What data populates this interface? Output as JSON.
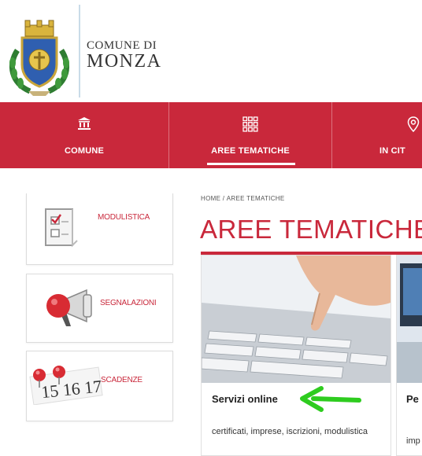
{
  "header": {
    "brand_small": "COMUNE DI",
    "brand_big": "MONZA",
    "crest_icon": "city-coat-of-arms"
  },
  "nav": {
    "items": [
      {
        "label": "COMUNE",
        "icon": "institution-icon"
      },
      {
        "label": "AREE TEMATICHE",
        "icon": "grid-icon",
        "active": true
      },
      {
        "label": "IN CIT",
        "icon": "map-pin-icon"
      }
    ]
  },
  "sidebar": {
    "items": [
      {
        "label": "MODULISTICA",
        "icon": "form-checklist-icon"
      },
      {
        "label": "SEGNALAZIONI",
        "icon": "megaphone-icon"
      },
      {
        "label": "SCADENZE",
        "icon": "calendar-dates-icon"
      }
    ]
  },
  "main": {
    "breadcrumb": [
      "HOME",
      "/",
      "AREE TEMATICHE"
    ],
    "title": "AREE TEMATICHE",
    "tiles": [
      {
        "title": "Servizi online",
        "desc": "certificati, imprese, iscrizioni, modulistica"
      },
      {
        "title": "Pe",
        "desc": "imp"
      }
    ]
  },
  "colors": {
    "accent": "#c9283b",
    "arrow": "#2ecc1f"
  }
}
